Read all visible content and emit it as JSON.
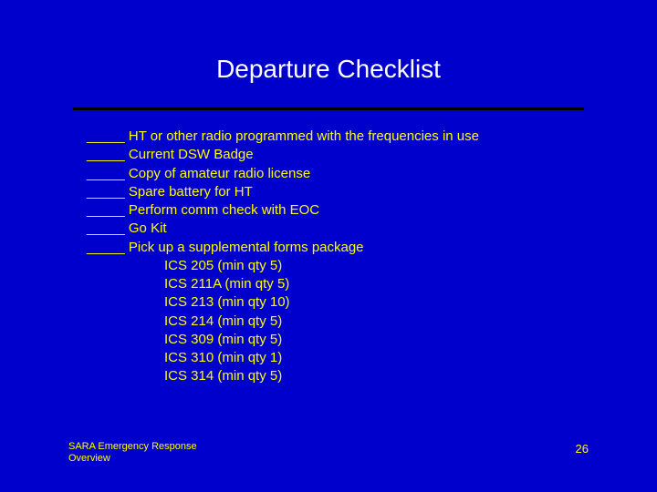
{
  "title": "Departure Checklist",
  "blank": "_____",
  "items": [
    " HT or other radio programmed with the frequencies in use",
    "Current DSW Badge",
    "Copy of amateur radio license",
    "Spare battery for HT",
    "Perform comm check with EOC",
    " Go Kit",
    "Pick up a supplemental forms package"
  ],
  "subitems": [
    "ICS 205 (min qty 5)",
    "ICS 211A (min qty 5)",
    "ICS 213 (min qty 10)",
    "ICS 214 (min qty 5)",
    "ICS 309 (min qty 5)",
    "ICS 310 (min qty 1)",
    "ICS 314 (min qty 5)"
  ],
  "footer": {
    "left_line1": "SARA Emergency Response",
    "left_line2": "Overview",
    "page": "26"
  }
}
